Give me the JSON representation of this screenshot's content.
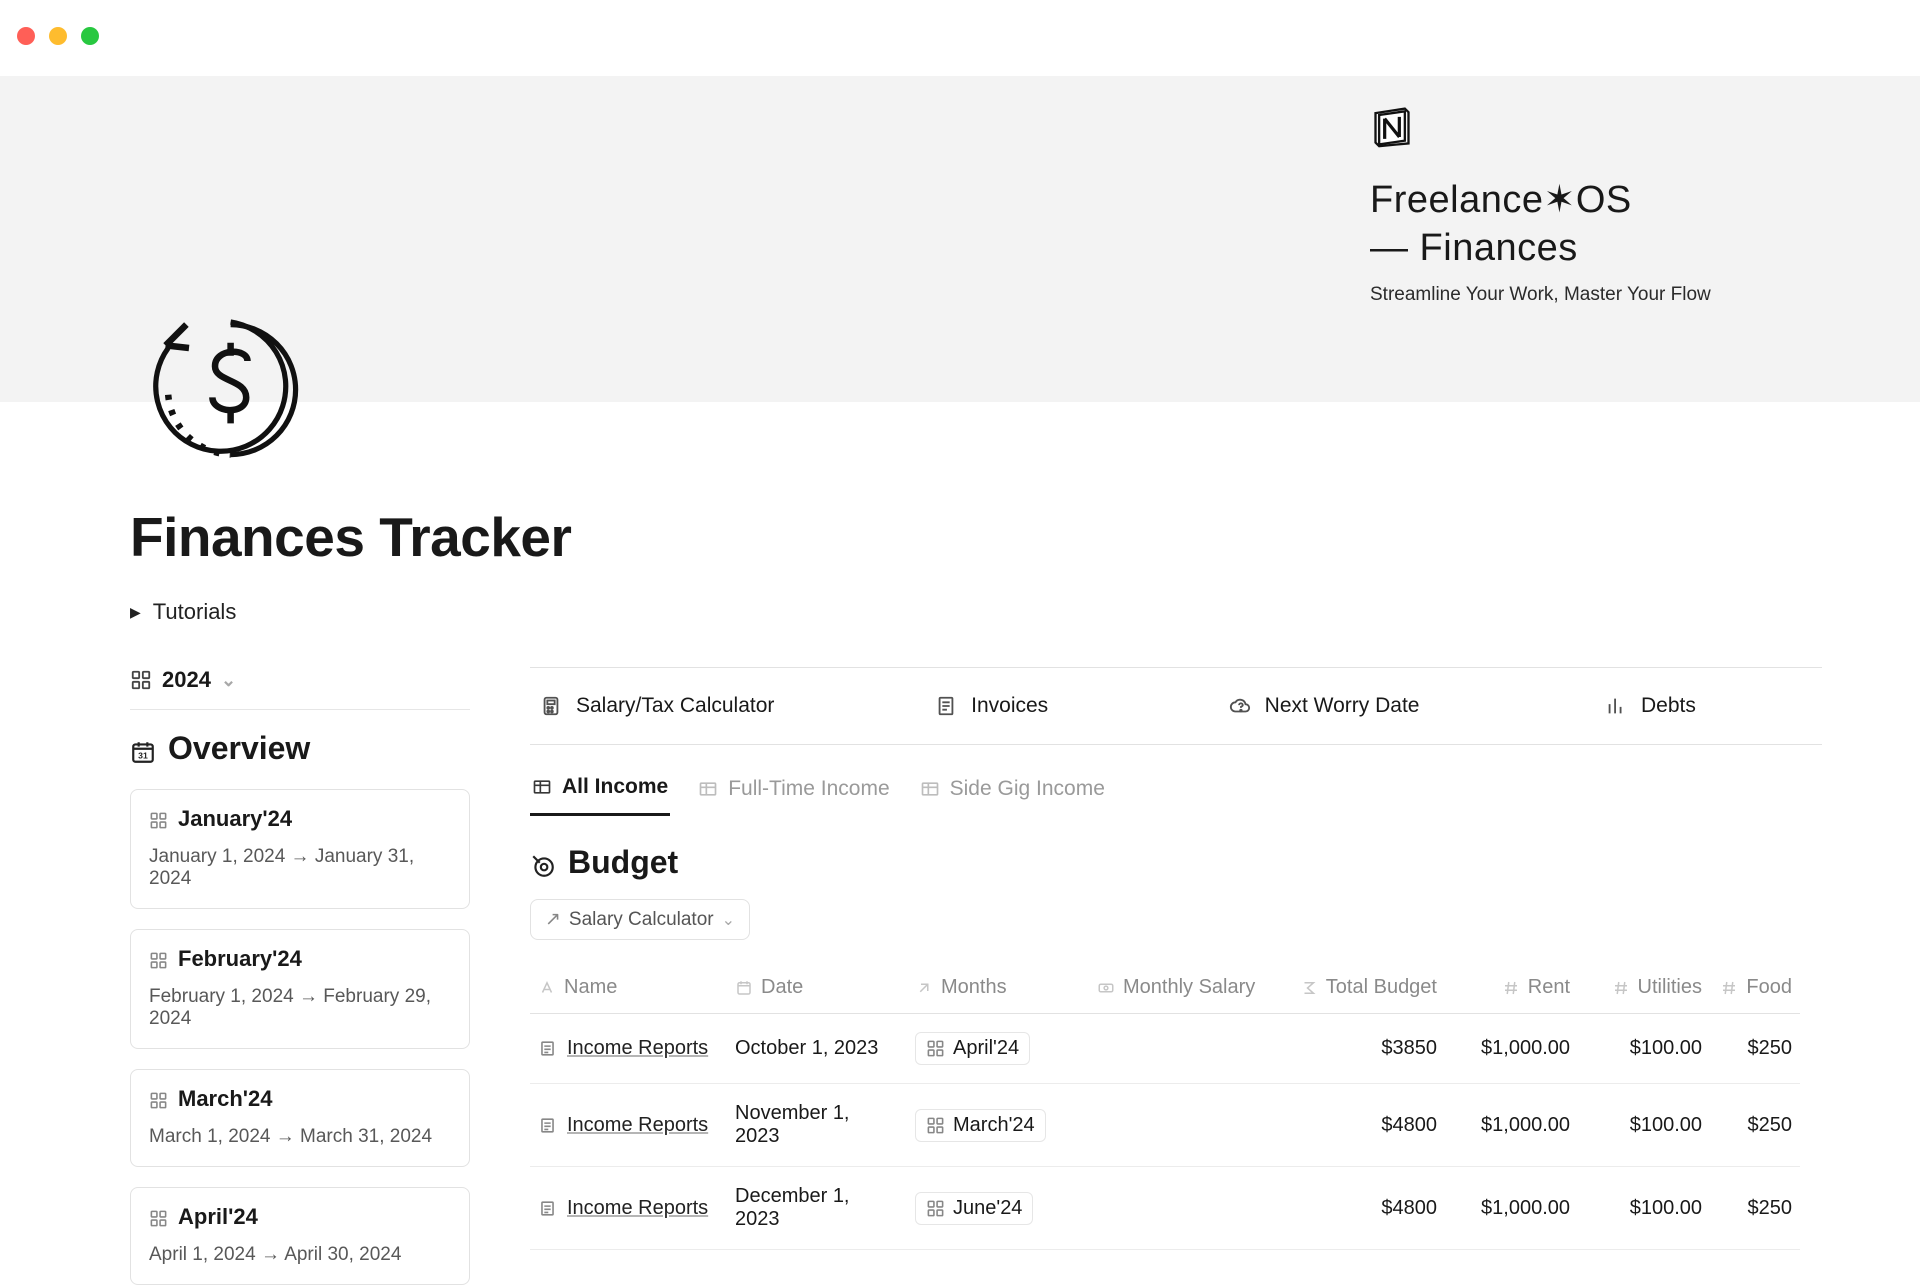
{
  "header": {
    "brand_line1": "Freelance✶OS",
    "brand_line2": "— Finances",
    "brand_tagline": "Streamline Your Work, Master Your Flow"
  },
  "page": {
    "title": "Finances Tracker",
    "tutorials_label": "Tutorials"
  },
  "sidebar": {
    "year_label": "2024",
    "overview_label": "Overview",
    "months": [
      {
        "title": "January'24",
        "range": "January 1, 2024 → January 31, 2024"
      },
      {
        "title": "February'24",
        "range": "February 1, 2024 → February 29, 2024"
      },
      {
        "title": "March'24",
        "range": "March 1, 2024 → March 31, 2024"
      },
      {
        "title": "April'24",
        "range": "April 1, 2024 → April 30, 2024"
      }
    ]
  },
  "toolbar": {
    "items": [
      {
        "label": "Salary/Tax Calculator"
      },
      {
        "label": "Invoices"
      },
      {
        "label": "Next Worry Date"
      },
      {
        "label": "Debts"
      }
    ]
  },
  "tabs": {
    "items": [
      {
        "label": "All Income"
      },
      {
        "label": "Full-Time Income"
      },
      {
        "label": "Side Gig Income"
      }
    ]
  },
  "budget": {
    "title": "Budget",
    "chip_label": "Salary Calculator",
    "columns": {
      "name": "Name",
      "date": "Date",
      "months": "Months",
      "monthly_salary": "Monthly Salary",
      "total_budget": "Total Budget",
      "rent": "Rent",
      "utilities": "Utilities",
      "food": "Food"
    },
    "rows": [
      {
        "name": "Income Reports",
        "date": "October 1, 2023",
        "month": "April'24",
        "monthly_salary": "",
        "total_budget": "$3850",
        "rent": "$1,000.00",
        "utilities": "$100.00",
        "food": "$250"
      },
      {
        "name": "Income Reports",
        "date": "November 1, 2023",
        "month": "March'24",
        "monthly_salary": "",
        "total_budget": "$4800",
        "rent": "$1,000.00",
        "utilities": "$100.00",
        "food": "$250"
      },
      {
        "name": "Income Reports",
        "date": "December 1, 2023",
        "month": "June'24",
        "monthly_salary": "",
        "total_budget": "$4800",
        "rent": "$1,000.00",
        "utilities": "$100.00",
        "food": "$250"
      }
    ]
  }
}
